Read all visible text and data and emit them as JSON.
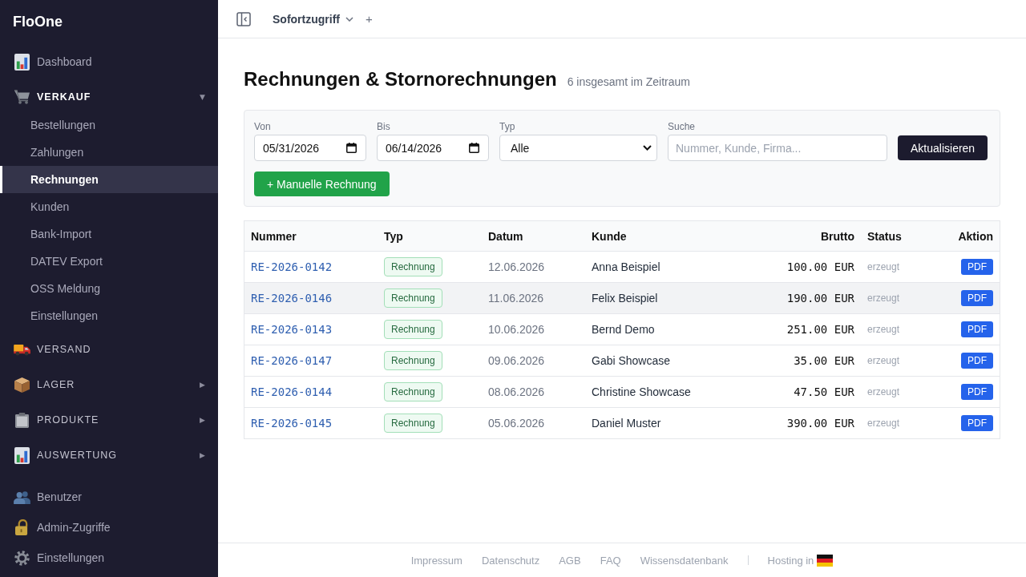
{
  "sidebar": {
    "brand": "FloOne",
    "items": [
      {
        "kind": "link",
        "label": "Dashboard",
        "selected": false
      },
      {
        "kind": "group",
        "label": "VERKAUF",
        "expanded": true,
        "caret": "▼",
        "children": [
          {
            "label": "Bestellungen",
            "selected": false
          },
          {
            "label": "Zahlungen",
            "selected": false
          },
          {
            "label": "Rechnungen",
            "selected": true
          },
          {
            "label": "Kunden",
            "selected": false
          },
          {
            "label": "Bank-Import",
            "selected": false
          },
          {
            "label": "DATEV Export",
            "selected": false
          },
          {
            "label": "OSS Meldung",
            "selected": false
          },
          {
            "label": "Einstellungen",
            "selected": false
          }
        ]
      },
      {
        "kind": "group",
        "label": "VERSAND",
        "expanded": false
      },
      {
        "kind": "group",
        "label": "LAGER",
        "expanded": false,
        "caret": "▶"
      },
      {
        "kind": "group",
        "label": "PRODUKTE",
        "expanded": false,
        "caret": "▶"
      },
      {
        "kind": "group",
        "label": "AUSWERTUNG",
        "expanded": false,
        "caret": "▶"
      }
    ],
    "admin_items": [
      {
        "label": "Benutzer",
        "selected": false
      },
      {
        "label": "Admin-Zugriffe",
        "selected": false
      },
      {
        "label": "Einstellungen",
        "selected": false
      }
    ]
  },
  "topbar": {
    "quick_access": "Sofortzugriff",
    "add_tab": "+"
  },
  "page": {
    "title": "Rechnungen & Stornorechnungen",
    "subtitle": "6 insgesamt im Zeitraum"
  },
  "filters": {
    "fields": [
      {
        "kind": "date",
        "label": "Von",
        "value": "05/31/2026"
      },
      {
        "kind": "date",
        "label": "Bis",
        "value": "06/14/2026"
      },
      {
        "kind": "select",
        "label": "Typ",
        "value": "Alle"
      },
      {
        "kind": "search",
        "label": "Suche",
        "placeholder": "Nummer, Kunde, Firma..."
      }
    ],
    "submit": "Aktualisieren",
    "add_button": "+ Manuelle Rechnung"
  },
  "table": {
    "columns": [
      {
        "label": "Nummer",
        "kind": "link"
      },
      {
        "label": "Typ",
        "kind": "badge"
      },
      {
        "label": "Datum",
        "kind": "date"
      },
      {
        "label": "Kunde",
        "kind": "text"
      },
      {
        "label": "Brutto",
        "kind": "amount"
      },
      {
        "label": "Status",
        "kind": "status"
      },
      {
        "label": "Aktion",
        "kind": "action"
      }
    ],
    "rows": [
      {
        "highlighted": false,
        "cells": [
          "RE-2026-0142",
          "Rechnung",
          "12.06.2026",
          "Anna Beispiel",
          "100.00 EUR",
          "erzeugt",
          "PDF"
        ]
      },
      {
        "highlighted": true,
        "cells": [
          "RE-2026-0146",
          "Rechnung",
          "11.06.2026",
          "Felix Beispiel",
          "190.00 EUR",
          "erzeugt",
          "PDF"
        ]
      },
      {
        "highlighted": false,
        "cells": [
          "RE-2026-0143",
          "Rechnung",
          "10.06.2026",
          "Bernd Demo",
          "251.00 EUR",
          "erzeugt",
          "PDF"
        ]
      },
      {
        "highlighted": false,
        "cells": [
          "RE-2026-0147",
          "Rechnung",
          "09.06.2026",
          "Gabi Showcase",
          "35.00 EUR",
          "erzeugt",
          "PDF"
        ]
      },
      {
        "highlighted": false,
        "cells": [
          "RE-2026-0144",
          "Rechnung",
          "08.06.2026",
          "Christine Showcase",
          "47.50 EUR",
          "erzeugt",
          "PDF"
        ]
      },
      {
        "highlighted": false,
        "cells": [
          "RE-2026-0145",
          "Rechnung",
          "05.06.2026",
          "Daniel Muster",
          "390.00 EUR",
          "erzeugt",
          "PDF"
        ]
      }
    ]
  },
  "footer": {
    "links": [
      "Impressum",
      "Datenschutz",
      "AGB",
      "FAQ",
      "Wissensdatenbank"
    ],
    "hosting": "Hosting in"
  }
}
